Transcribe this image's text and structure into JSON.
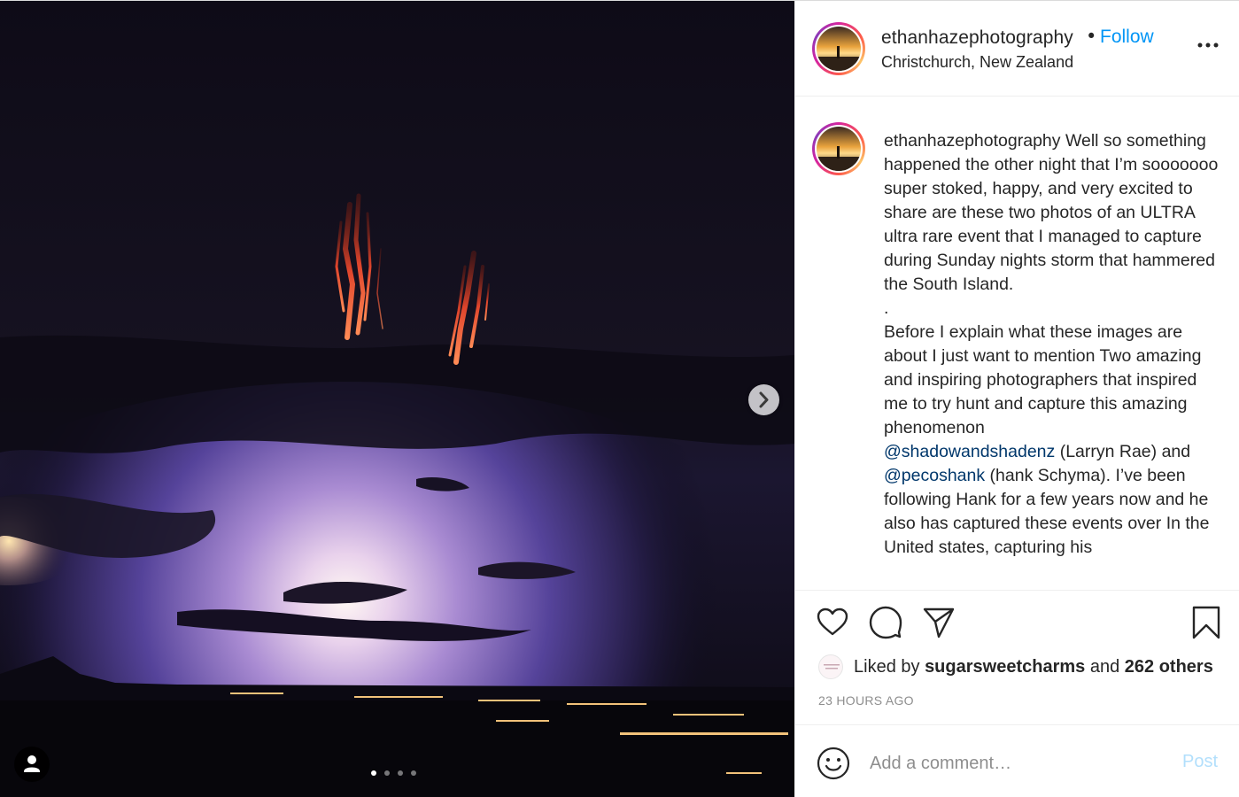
{
  "post": {
    "username": "ethanhazephotography",
    "separator": "•",
    "follow_label": "Follow",
    "location": "Christchurch, New Zealand",
    "more_icon": "more-horizontal-icon",
    "carousel": {
      "slide_count": 4,
      "active_index": 0
    }
  },
  "caption": {
    "username": "ethanhazephotography",
    "p1": "Well so something happened the other night that I’m sooooooo super stoked, happy, and very excited to share are these two photos of an ULTRA ultra rare event that I managed to capture during Sunday nights storm that hammered the South Island.",
    "dot": ".",
    "p2": "Before I explain what these images are about I just want to mention Two amazing and inspiring photographers that inspired me to try hunt and capture this amazing phenomenon",
    "mention1": "@shadowandshadenz",
    "t3": " (Larryn Rae) and",
    "mention2": "@pecoshank",
    "t4": " (hank Schyma). I’ve been following Hank for a few years now and he also has captured these events over In the United states, capturing his"
  },
  "likes": {
    "prefix": "Liked by",
    "user": "sugarsweetcharms",
    "conj": "and",
    "others": "262 others"
  },
  "timestamp": "23 HOURS AGO",
  "comment": {
    "placeholder": "Add a comment…",
    "post_label": "Post"
  },
  "colors": {
    "follow": "#0095f6",
    "mention": "#00376b",
    "post_disabled": "#b2dffc",
    "muted": "#8e8e8e"
  }
}
